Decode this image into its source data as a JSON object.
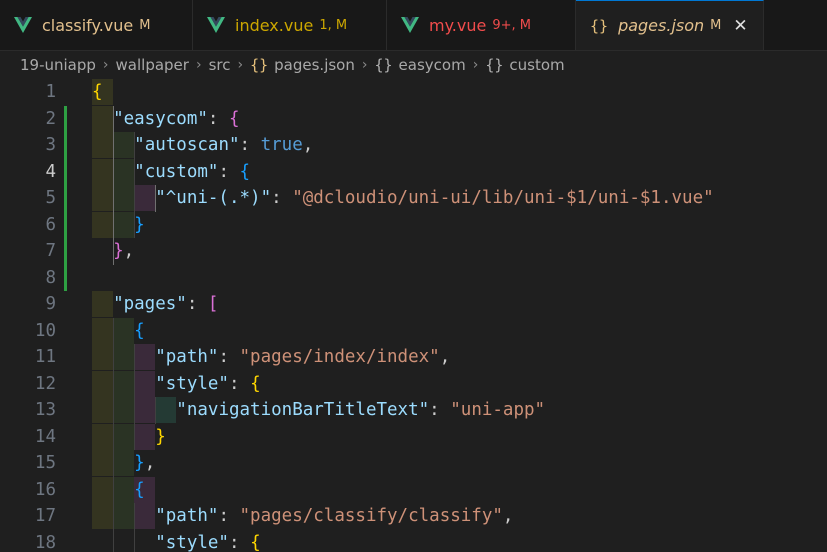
{
  "tabs": [
    {
      "label": "classify.vue",
      "status": "M",
      "icon": "vue-icon",
      "color": "#e2c08d",
      "status_color": "#e2c08d"
    },
    {
      "label": "index.vue",
      "status": "1, M",
      "icon": "vue-icon",
      "color": "#cca700",
      "status_color": "#cca700"
    },
    {
      "label": "my.vue",
      "status": "9+, M",
      "icon": "vue-icon",
      "color": "#f14c4c",
      "status_color": "#f14c4c"
    },
    {
      "label": "pages.json",
      "status": "M",
      "icon": "json-icon",
      "color": "#e2c08d",
      "status_color": "#e2c08d",
      "active": true
    }
  ],
  "breadcrumb": {
    "items": [
      "19-uniapp",
      "wallpaper",
      "src",
      "pages.json",
      "easycom",
      "custom"
    ],
    "json_glyph": "{}",
    "obj_glyph": "{}",
    "separator": "›"
  },
  "editor": {
    "current_line": 4,
    "lines": [
      {
        "n": "1",
        "tokens": [
          [
            "y",
            "{"
          ]
        ]
      },
      {
        "n": "2",
        "tokens": [
          [
            "p",
            "  "
          ],
          [
            "k",
            "\"easycom\""
          ],
          [
            "p",
            ": "
          ],
          [
            "m",
            "{"
          ]
        ]
      },
      {
        "n": "3",
        "tokens": [
          [
            "p",
            "    "
          ],
          [
            "k",
            "\"autoscan\""
          ],
          [
            "p",
            ": "
          ],
          [
            "b",
            "true"
          ],
          [
            "p",
            ","
          ]
        ]
      },
      {
        "n": "4",
        "tokens": [
          [
            "p",
            "    "
          ],
          [
            "k",
            "\"custom\""
          ],
          [
            "p",
            ": "
          ],
          [
            "c",
            "{"
          ]
        ]
      },
      {
        "n": "5",
        "tokens": [
          [
            "p",
            "      "
          ],
          [
            "k",
            "\"^uni-(.*)\""
          ],
          [
            "p",
            ": "
          ],
          [
            "s",
            "\"@dcloudio/uni-ui/lib/uni-$1/uni-$1.vue\""
          ]
        ]
      },
      {
        "n": "6",
        "tokens": [
          [
            "p",
            "    "
          ],
          [
            "c",
            "}"
          ]
        ]
      },
      {
        "n": "7",
        "tokens": [
          [
            "p",
            "  "
          ],
          [
            "m",
            "}"
          ],
          [
            "p",
            ","
          ]
        ]
      },
      {
        "n": "8",
        "tokens": []
      },
      {
        "n": "9",
        "tokens": [
          [
            "p",
            "  "
          ],
          [
            "k",
            "\"pages\""
          ],
          [
            "p",
            ": "
          ],
          [
            "m",
            "["
          ]
        ]
      },
      {
        "n": "10",
        "tokens": [
          [
            "p",
            "    "
          ],
          [
            "c",
            "{"
          ]
        ]
      },
      {
        "n": "11",
        "tokens": [
          [
            "p",
            "      "
          ],
          [
            "k",
            "\"path\""
          ],
          [
            "p",
            ": "
          ],
          [
            "s",
            "\"pages/index/index\""
          ],
          [
            "p",
            ","
          ]
        ]
      },
      {
        "n": "12",
        "tokens": [
          [
            "p",
            "      "
          ],
          [
            "k",
            "\"style\""
          ],
          [
            "p",
            ": "
          ],
          [
            "y",
            "{"
          ]
        ]
      },
      {
        "n": "13",
        "tokens": [
          [
            "p",
            "        "
          ],
          [
            "k",
            "\"navigationBarTitleText\""
          ],
          [
            "p",
            ": "
          ],
          [
            "s",
            "\"uni-app\""
          ]
        ]
      },
      {
        "n": "14",
        "tokens": [
          [
            "p",
            "      "
          ],
          [
            "y",
            "}"
          ]
        ]
      },
      {
        "n": "15",
        "tokens": [
          [
            "p",
            "    "
          ],
          [
            "c",
            "}"
          ],
          [
            "p",
            ","
          ]
        ]
      },
      {
        "n": "16",
        "tokens": [
          [
            "p",
            "    "
          ],
          [
            "c",
            "{"
          ]
        ]
      },
      {
        "n": "17",
        "tokens": [
          [
            "p",
            "      "
          ],
          [
            "k",
            "\"path\""
          ],
          [
            "p",
            ": "
          ],
          [
            "s",
            "\"pages/classify/classify\""
          ],
          [
            "p",
            ","
          ]
        ]
      },
      {
        "n": "18",
        "tokens": [
          [
            "p",
            "      "
          ],
          [
            "k",
            "\"style\""
          ],
          [
            "p",
            ": "
          ],
          [
            "y",
            "{"
          ]
        ]
      }
    ]
  },
  "colors": {
    "background": "#1f1f1f",
    "tabbar": "#181818",
    "accent": "#0078d4",
    "modified_gutter": "#2ea043"
  }
}
